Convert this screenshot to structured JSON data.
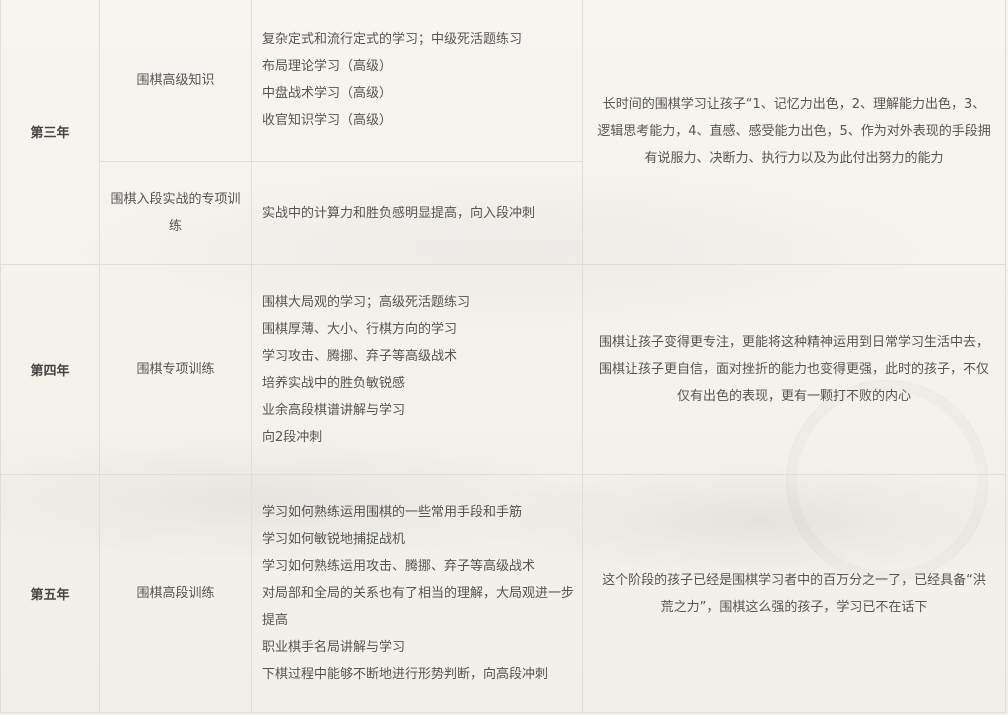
{
  "rows": [
    {
      "year": "第三年",
      "result": "长时间的围棋学习让孩子“1、记忆力出色，2、理解能力出色，3、逻辑思考能力，4、直感、感受能力出色，5、作为对外表现的手段拥有说服力、决断力、执行力以及为此付出努力的能力",
      "topics": [
        {
          "title": "围棋高级知识",
          "lines": [
            "复杂定式和流行定式的学习；中级死活题练习",
            "布局理论学习（高级）",
            "中盘战术学习（高级）",
            "收官知识学习（高级）"
          ]
        },
        {
          "title": "围棋入段实战的专项训练",
          "lines": [
            "实战中的计算力和胜负感明显提高，向入段冲刺"
          ]
        }
      ]
    },
    {
      "year": "第四年",
      "topic": "围棋专项训练",
      "lines": [
        "围棋大局观的学习；高级死活题练习",
        "围棋厚薄、大小、行棋方向的学习",
        "学习攻击、腾挪、弃子等高级战术",
        "培养实战中的胜负敏锐感",
        "业余高段棋谱讲解与学习",
        "向2段冲刺"
      ],
      "result": "围棋让孩子变得更专注，更能将这种精神运用到日常学习生活中去，围棋让孩子更自信，面对挫折的能力也变得更强，此时的孩子，不仅仅有出色的表现，更有一颗打不败的内心"
    },
    {
      "year": "第五年",
      "topic": "围棋高段训练",
      "lines": [
        "学习如何熟练运用围棋的一些常用手段和手筋",
        "学习如何敏锐地捕捉战机",
        "学习如何熟练运用攻击、腾挪、弃子等高级战术",
        "对局部和全局的关系也有了相当的理解，大局观进一步提高",
        "职业棋手名局讲解与学习",
        "下棋过程中能够不断地进行形势判断，向高段冲刺"
      ],
      "result": "这个阶段的孩子已经是围棋学习者中的百万分之一了，已经具备“洪荒之力”，围棋这么强的孩子，学习已不在话下"
    }
  ]
}
